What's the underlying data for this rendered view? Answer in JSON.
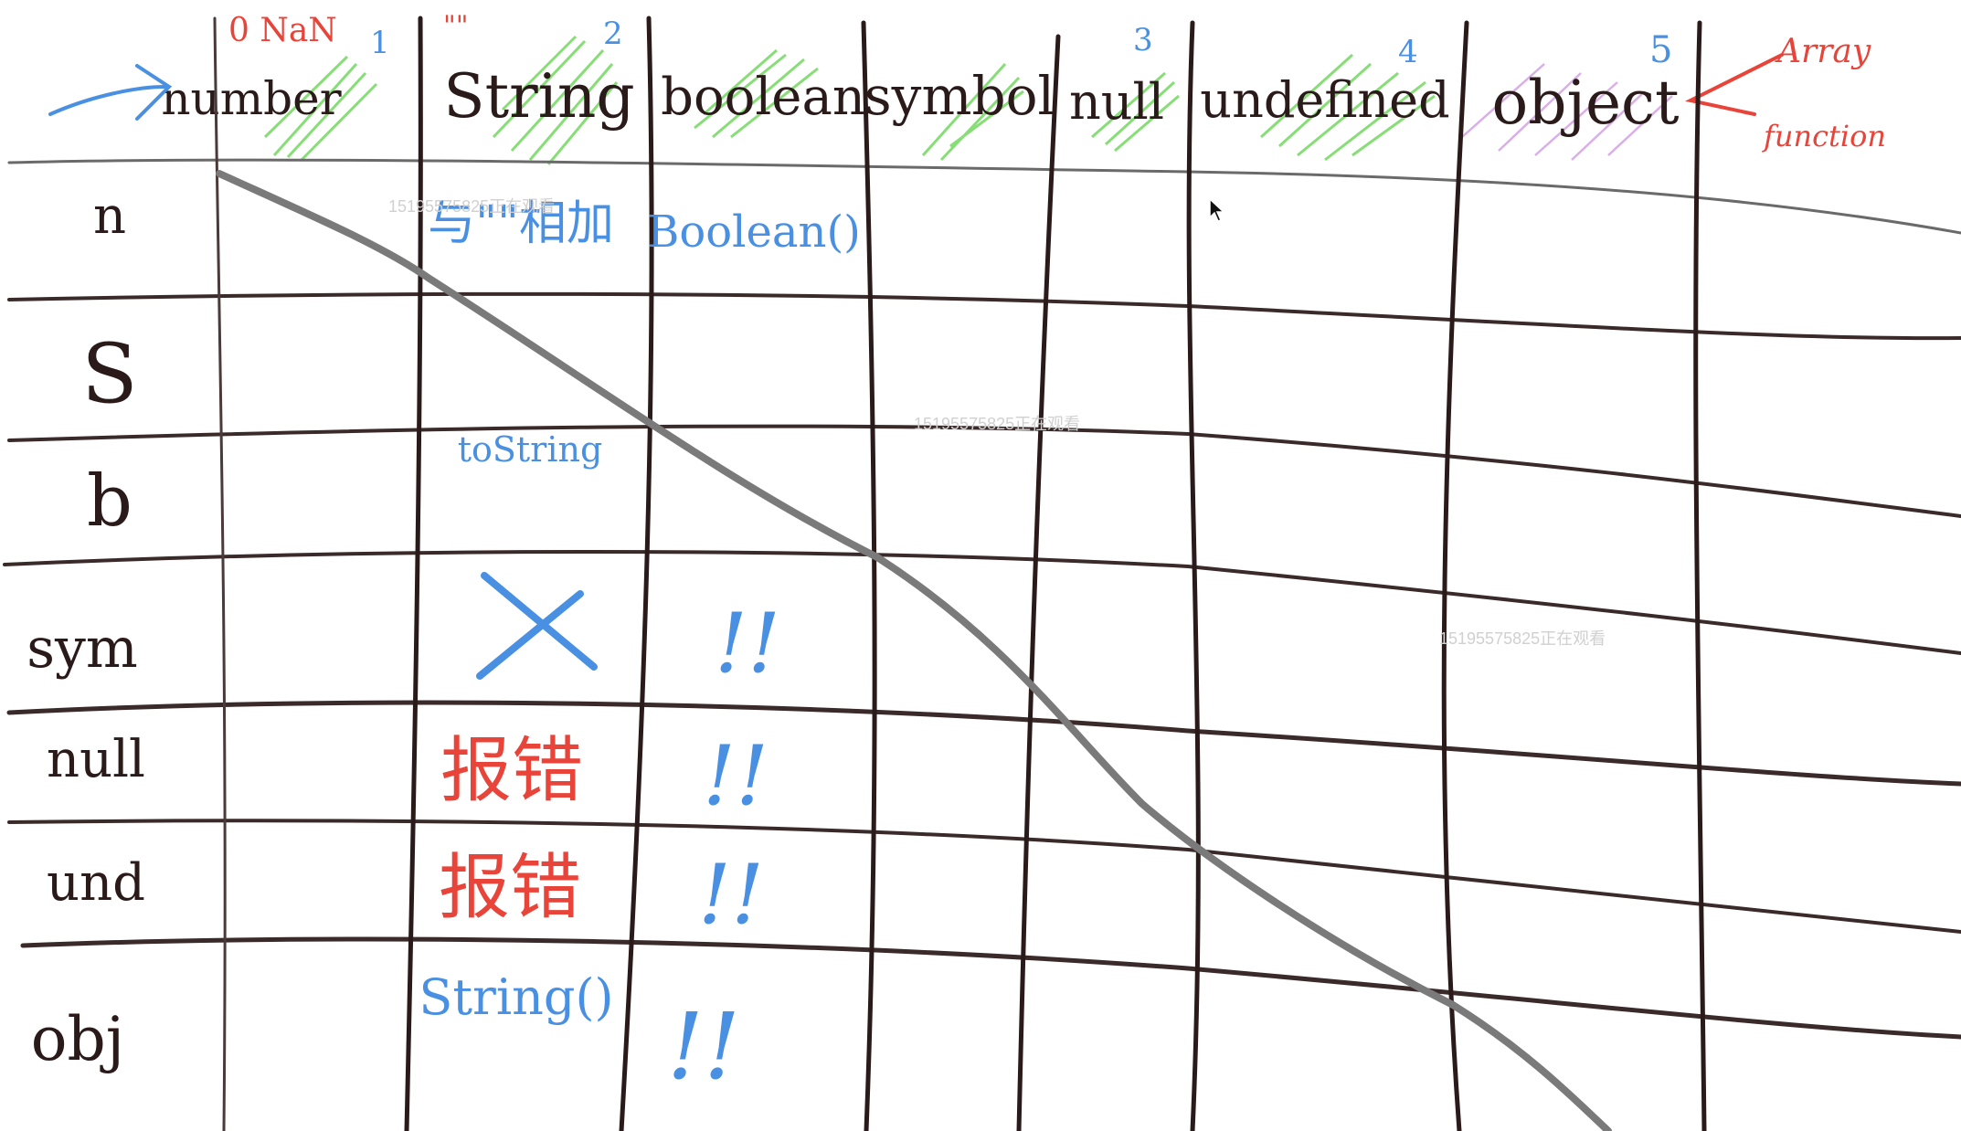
{
  "watermark": "15195575825正在观看",
  "column_headers": [
    {
      "label": "number",
      "default_hint": "0 NaN",
      "index": "1"
    },
    {
      "label": "String",
      "default_hint": "\"\"",
      "index": "2"
    },
    {
      "label": "boolean",
      "default_hint": "",
      "index": ""
    },
    {
      "label": "symbol",
      "default_hint": "",
      "index": ""
    },
    {
      "label": "null",
      "default_hint": "",
      "index": "3"
    },
    {
      "label": "undefined",
      "default_hint": "",
      "index": "4"
    },
    {
      "label": "object",
      "default_hint": "",
      "index": "5"
    }
  ],
  "object_subtypes": [
    "Array",
    "function"
  ],
  "row_headers": [
    "n",
    "S",
    "b",
    "sym",
    "null",
    "und",
    "obj"
  ],
  "cells": {
    "n_string": "与\"\"相加",
    "n_boolean": "Boolean()",
    "b_string": "toString",
    "sym_string": "X",
    "sym_boolean": "!!",
    "null_string": "报错",
    "null_boolean": "!!",
    "und_string": "报错",
    "und_boolean": "!!",
    "obj_string": "String()",
    "obj_boolean": "!!"
  },
  "colors": {
    "ink": "#2a1a1a",
    "blue": "#4a90e2",
    "red": "#e8443a",
    "green": "#5fd34a",
    "purple": "#c98be0",
    "gray": "#808080"
  }
}
